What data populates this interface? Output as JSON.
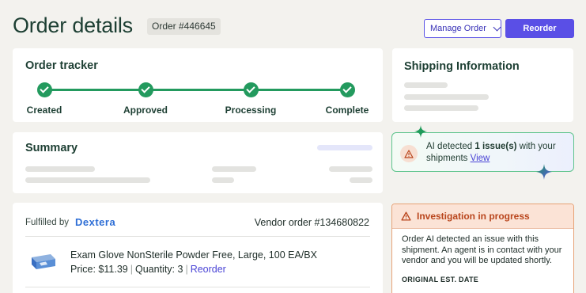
{
  "header": {
    "title": "Order details",
    "order_badge": "Order #446645",
    "manage_label": "Manage Order",
    "reorder_label": "Reorder"
  },
  "tracker": {
    "title": "Order tracker",
    "steps": [
      {
        "label": "Created",
        "done": true
      },
      {
        "label": "Approved",
        "done": true
      },
      {
        "label": "Processing",
        "done": true
      },
      {
        "label": "Complete",
        "done": true
      }
    ]
  },
  "summary": {
    "title": "Summary"
  },
  "shipping": {
    "title": "Shipping Information"
  },
  "ai_notice": {
    "prefix": "AI detected ",
    "count": "1 issue(s)",
    "suffix": " with your shipments ",
    "link": "View"
  },
  "fulfillment": {
    "label": "Fulfilled by",
    "brand": "Dextera",
    "vendor_order": "Vendor order #134680822",
    "product": {
      "name": "Exam Glove NonSterile Powder Free, Large, 100 EA/BX",
      "price": "Price: $11.39",
      "quantity": "Quantity: 3",
      "reorder_link": "Reorder"
    }
  },
  "investigation": {
    "title": "Investigation in progress",
    "body": "Order AI detected an issue with this shipment. An agent is in contact with your vendor and you will be updated shortly.",
    "subheading": "ORIGINAL EST. DATE"
  },
  "colors": {
    "accent": "#5a4fe6",
    "success": "#239a5e",
    "warning": "#b9451c",
    "heading": "#1d3f33"
  },
  "icons": [
    "check-icon",
    "chevron-down-icon",
    "alert-triangle-icon",
    "sparkle-icon",
    "glove-box-icon"
  ]
}
